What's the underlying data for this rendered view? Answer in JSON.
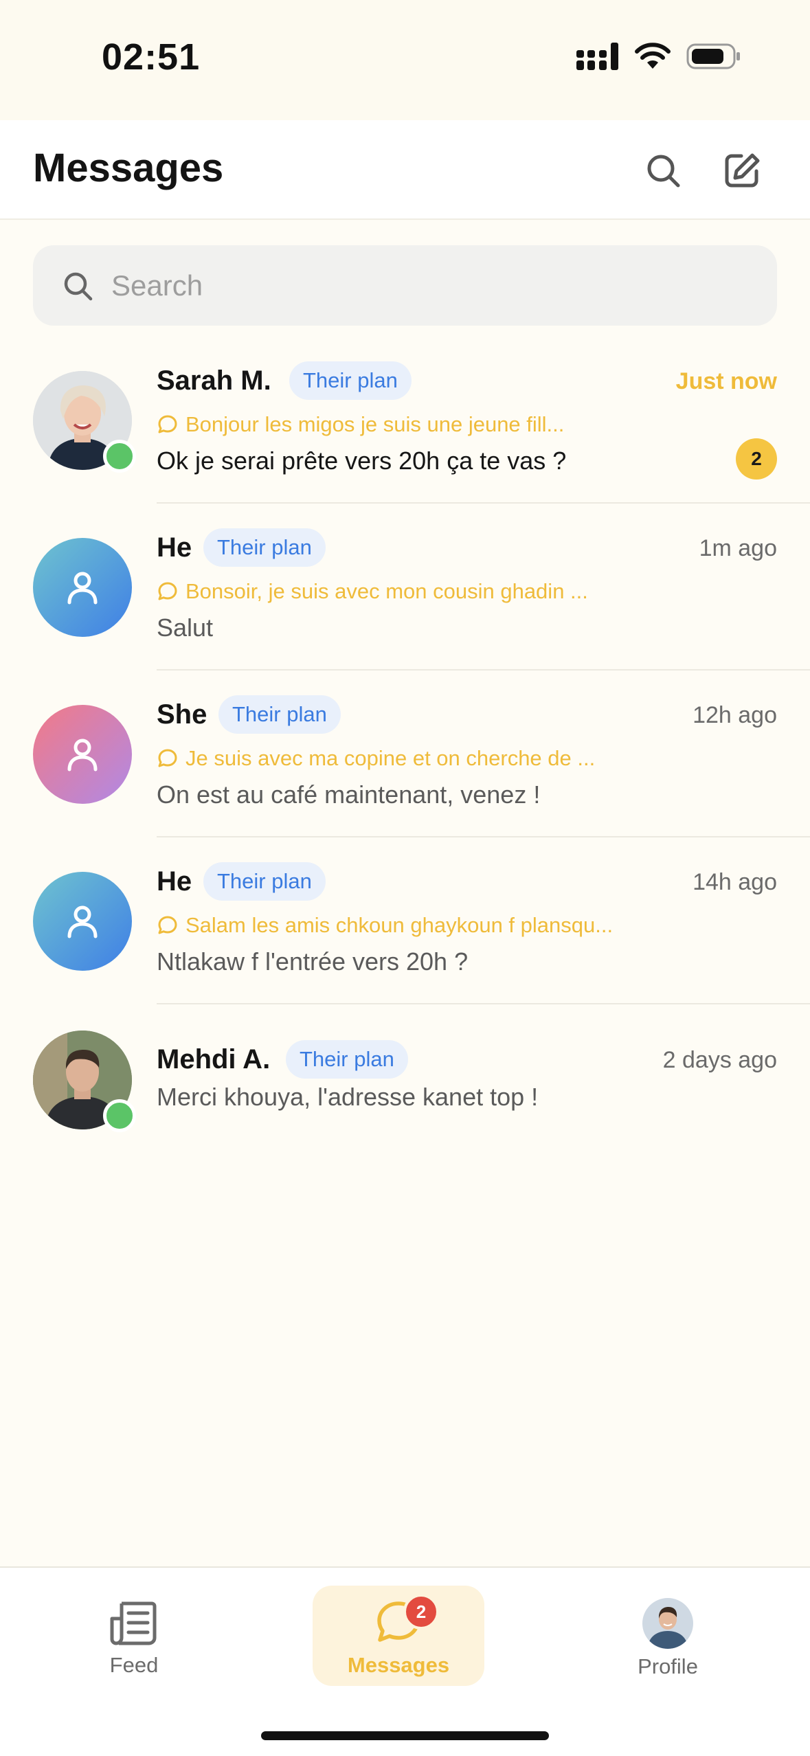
{
  "status_bar": {
    "time": "02:51"
  },
  "header": {
    "title": "Messages"
  },
  "search": {
    "placeholder": "Search"
  },
  "conversations": [
    {
      "name": "Sarah M.",
      "badge": "Their plan",
      "time": "Just now",
      "quote": "Bonjour les migos je suis une jeune fill...",
      "last_message": "Ok je serai prête vers 20h ça te vas ?",
      "unread": "2",
      "online": true,
      "avatar": "photo"
    },
    {
      "name": "He",
      "badge": "Their plan",
      "time": "1m ago",
      "quote": "Bonsoir, je suis avec mon cousin ghadin ...",
      "last_message": "Salut",
      "avatar": "blue-person-icon"
    },
    {
      "name": "She",
      "badge": "Their plan",
      "time": "12h ago",
      "quote": "Je suis avec ma copine et on cherche de ...",
      "last_message": "On est au café maintenant, venez !",
      "avatar": "pink-person-icon"
    },
    {
      "name": "He",
      "badge": "Their plan",
      "time": "14h ago",
      "quote": "Salam les amis chkoun ghaykoun f plansqu...",
      "last_message": "Ntlakaw f l'entrée vers 20h ?",
      "avatar": "blue-person-icon"
    },
    {
      "name": "Mehdi A.",
      "badge": "Their plan",
      "time": "2 days ago",
      "last_message": "Merci khouya, l'adresse kanet top !",
      "online": true,
      "avatar": "photo"
    }
  ],
  "nav": {
    "feed": "Feed",
    "messages": "Messages",
    "messages_badge": "2",
    "profile": "Profile"
  },
  "colors": {
    "accent": "#efbb3a",
    "badge_blue": "#3a7be0",
    "online": "#5bc467",
    "alert": "#e34b3f"
  }
}
